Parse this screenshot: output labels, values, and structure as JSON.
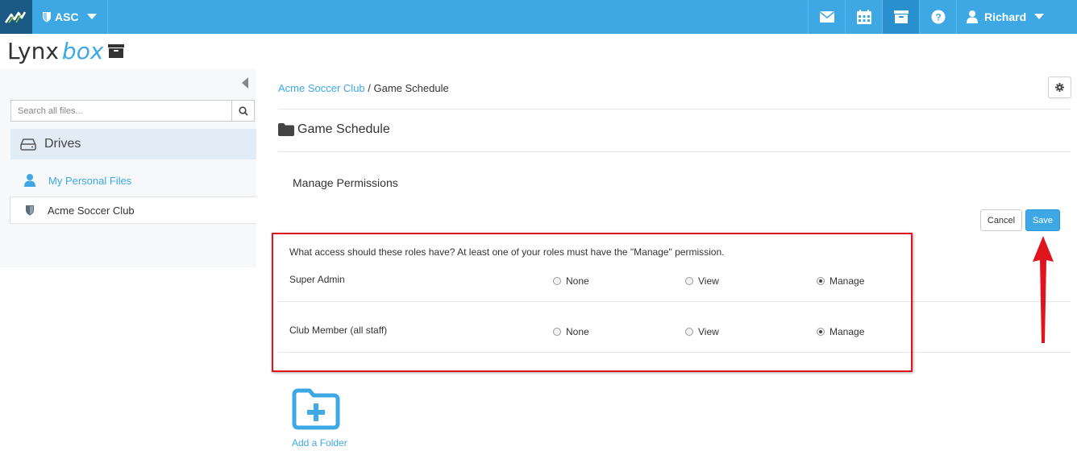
{
  "topbar": {
    "org_label": "ASC",
    "user_label": "Richard",
    "icons": [
      "mail-icon",
      "calendar-icon",
      "archive-icon",
      "help-icon"
    ]
  },
  "brand": {
    "part_a": "Lynx",
    "part_b": "box"
  },
  "sidebar": {
    "search_placeholder": "Search all files...",
    "drives_label": "Drives",
    "items": [
      {
        "label": "My Personal Files"
      },
      {
        "label": "Acme Soccer Club"
      }
    ]
  },
  "breadcrumb": {
    "parent": "Acme Soccer Club",
    "separator": " / ",
    "current": "Game Schedule"
  },
  "folder_title": "Game Schedule",
  "manage_permissions": {
    "title": "Manage Permissions",
    "cancel_label": "Cancel",
    "save_label": "Save",
    "question": "What access should these roles have? At least one of your roles must have the \"Manage\" permission.",
    "roles": [
      {
        "name": "Super Admin",
        "options": [
          "None",
          "View",
          "Manage"
        ],
        "selected": "Manage"
      },
      {
        "name": "Club Member (all staff)",
        "options": [
          "None",
          "View",
          "Manage"
        ],
        "selected": "Manage"
      }
    ]
  },
  "add_folder_label": "Add a Folder",
  "colors": {
    "accent": "#3ea8e5",
    "highlight": "#e0141d",
    "topbar_dark": "#1c5a86"
  }
}
